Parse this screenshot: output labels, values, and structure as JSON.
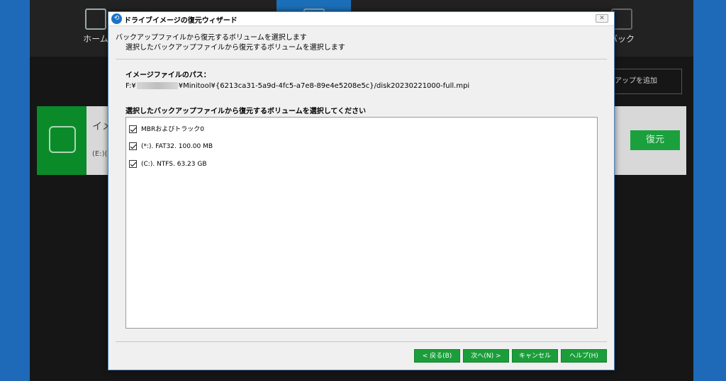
{
  "background_app": {
    "nav": [
      {
        "label": "ホーム",
        "icon": "home-icon"
      },
      {
        "label": "",
        "icon": "tools-icon"
      },
      {
        "label": "",
        "icon": "backup-icon"
      },
      {
        "label": "",
        "icon": "sync-icon"
      },
      {
        "label": "",
        "icon": "disk-icon"
      },
      {
        "label": "",
        "icon": "media-icon"
      },
      {
        "label": "バック",
        "icon": "backup-icon"
      }
    ],
    "add_backup_label": "アップを追加",
    "card": {
      "title": "イメ",
      "sub": "(E:)(",
      "restore_label": "復元"
    }
  },
  "dialog": {
    "title": "ドライブイメージの復元ウィザード",
    "close_label": "✕",
    "header_title": "バックアップファイルから復元するボリュームを選択します",
    "header_subtitle": "選択したバックアップファイルから復元するボリュームを選択します",
    "path_label": "イメージファイルのパス：",
    "path_prefix": "F:¥",
    "path_suffix": "¥Minitool¥{6213ca31-5a9d-4fc5-a7e8-89e4e5208e5c}/disk20230221000-full.mpi",
    "list_label": "選択したバックアップファイルから復元するボリュームを選択してください",
    "volumes": [
      {
        "label": "MBRおよびトラック0",
        "checked": true
      },
      {
        "label": "(*:). FAT32. 100.00 MB",
        "checked": true
      },
      {
        "label": "(C:). NTFS. 63.23 GB",
        "checked": true
      }
    ],
    "buttons": {
      "back": "< 戻る(B)",
      "next": "次へ(N) >",
      "cancel": "キャンセル",
      "help": "ヘルプ(H)"
    }
  },
  "colors": {
    "accent_green": "#1b9e3a",
    "outer_blue": "#1e6ab8",
    "app_dark": "#161616"
  }
}
